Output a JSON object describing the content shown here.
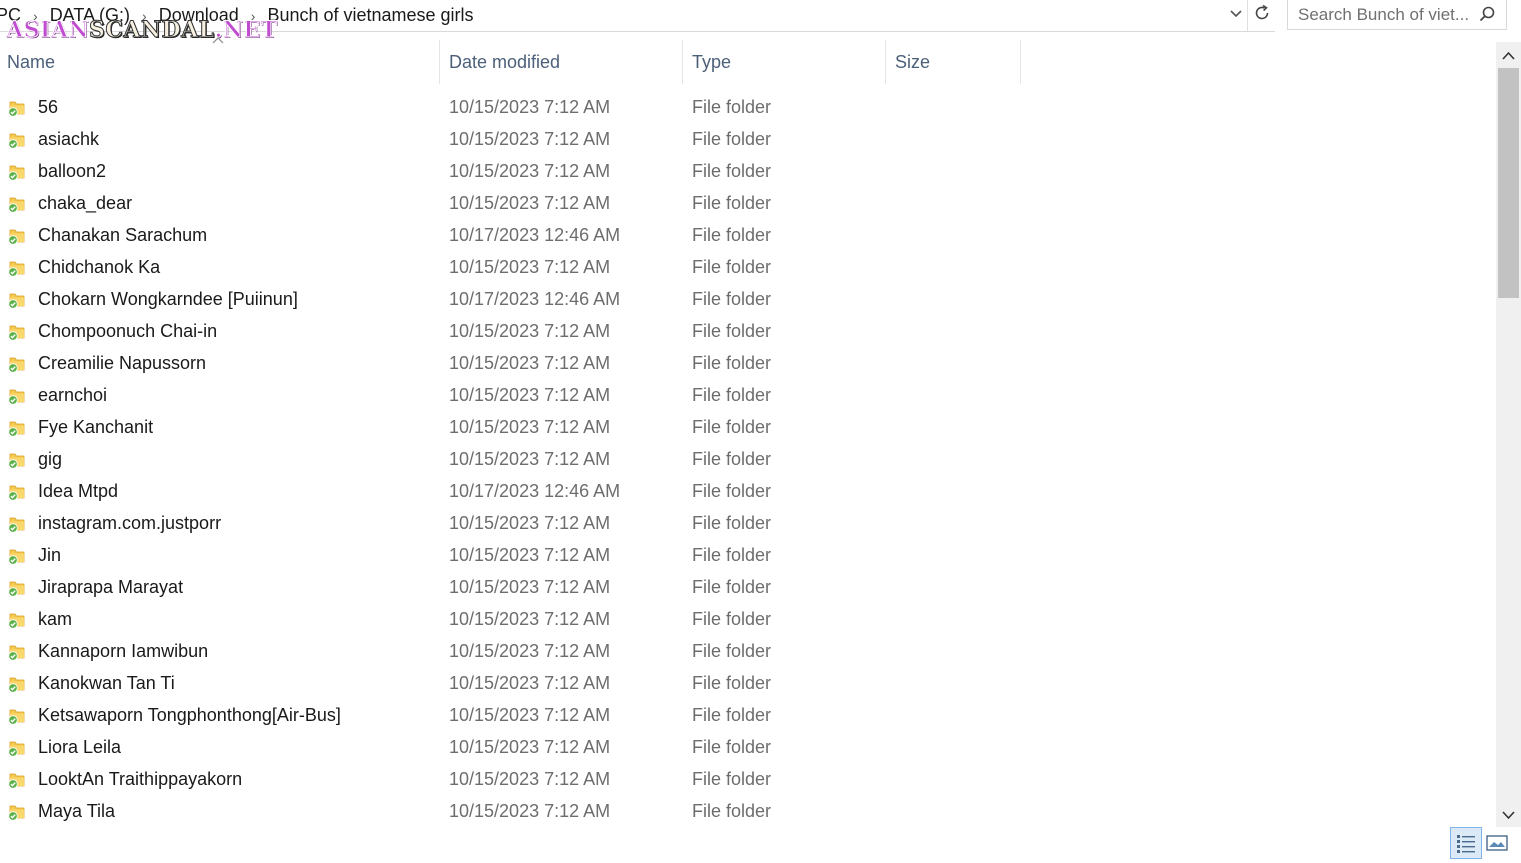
{
  "breadcrumb": {
    "items": [
      "PC",
      "DATA (G:)",
      "Download",
      "Bunch of vietnamese girls"
    ]
  },
  "search": {
    "placeholder": "Search Bunch of viet..."
  },
  "watermark": {
    "part1": "ASIAN",
    "part2": "SCANDAL",
    "part3": ".NET"
  },
  "columns": {
    "name": "Name",
    "date": "Date modified",
    "type": "Type",
    "size": "Size"
  },
  "files": [
    {
      "name": "56",
      "date": "10/15/2023 7:12 AM",
      "type": "File folder"
    },
    {
      "name": "asiachk",
      "date": "10/15/2023 7:12 AM",
      "type": "File folder"
    },
    {
      "name": "balloon2",
      "date": "10/15/2023 7:12 AM",
      "type": "File folder"
    },
    {
      "name": "chaka_dear",
      "date": "10/15/2023 7:12 AM",
      "type": "File folder"
    },
    {
      "name": "Chanakan Sarachum",
      "date": "10/17/2023 12:46 AM",
      "type": "File folder"
    },
    {
      "name": "Chidchanok Ka",
      "date": "10/15/2023 7:12 AM",
      "type": "File folder"
    },
    {
      "name": "Chokarn Wongkarndee [Puiinun]",
      "date": "10/17/2023 12:46 AM",
      "type": "File folder"
    },
    {
      "name": "Chompoonuch Chai-in",
      "date": "10/15/2023 7:12 AM",
      "type": "File folder"
    },
    {
      "name": "Creamilie Napussorn",
      "date": "10/15/2023 7:12 AM",
      "type": "File folder"
    },
    {
      "name": "earnchoi",
      "date": "10/15/2023 7:12 AM",
      "type": "File folder"
    },
    {
      "name": "Fye Kanchanit",
      "date": "10/15/2023 7:12 AM",
      "type": "File folder"
    },
    {
      "name": "gig",
      "date": "10/15/2023 7:12 AM",
      "type": "File folder"
    },
    {
      "name": "Idea Mtpd",
      "date": "10/17/2023 12:46 AM",
      "type": "File folder"
    },
    {
      "name": "instagram.com.justporr",
      "date": "10/15/2023 7:12 AM",
      "type": "File folder"
    },
    {
      "name": "Jin",
      "date": "10/15/2023 7:12 AM",
      "type": "File folder"
    },
    {
      "name": "Jiraprapa Marayat",
      "date": "10/15/2023 7:12 AM",
      "type": "File folder"
    },
    {
      "name": "kam",
      "date": "10/15/2023 7:12 AM",
      "type": "File folder"
    },
    {
      "name": "Kannaporn Iamwibun",
      "date": "10/15/2023 7:12 AM",
      "type": "File folder"
    },
    {
      "name": "Kanokwan Tan Ti",
      "date": "10/15/2023 7:12 AM",
      "type": "File folder"
    },
    {
      "name": "Ketsawaporn Tongphonthong[Air-Bus]",
      "date": "10/15/2023 7:12 AM",
      "type": "File folder"
    },
    {
      "name": "Liora Leila",
      "date": "10/15/2023 7:12 AM",
      "type": "File folder"
    },
    {
      "name": "LooktAn Traithippayakorn",
      "date": "10/15/2023 7:12 AM",
      "type": "File folder"
    },
    {
      "name": "Maya Tila",
      "date": "10/15/2023 7:12 AM",
      "type": "File folder"
    }
  ],
  "icons": {
    "folder": "folder-synced-icon",
    "refresh": "refresh-icon",
    "search": "search-icon"
  },
  "colors": {
    "folder_yellow": "#f6c64e",
    "sync_green": "#5ab24a",
    "header_text": "#4c607a",
    "secondary_text": "#6d6d6d"
  }
}
